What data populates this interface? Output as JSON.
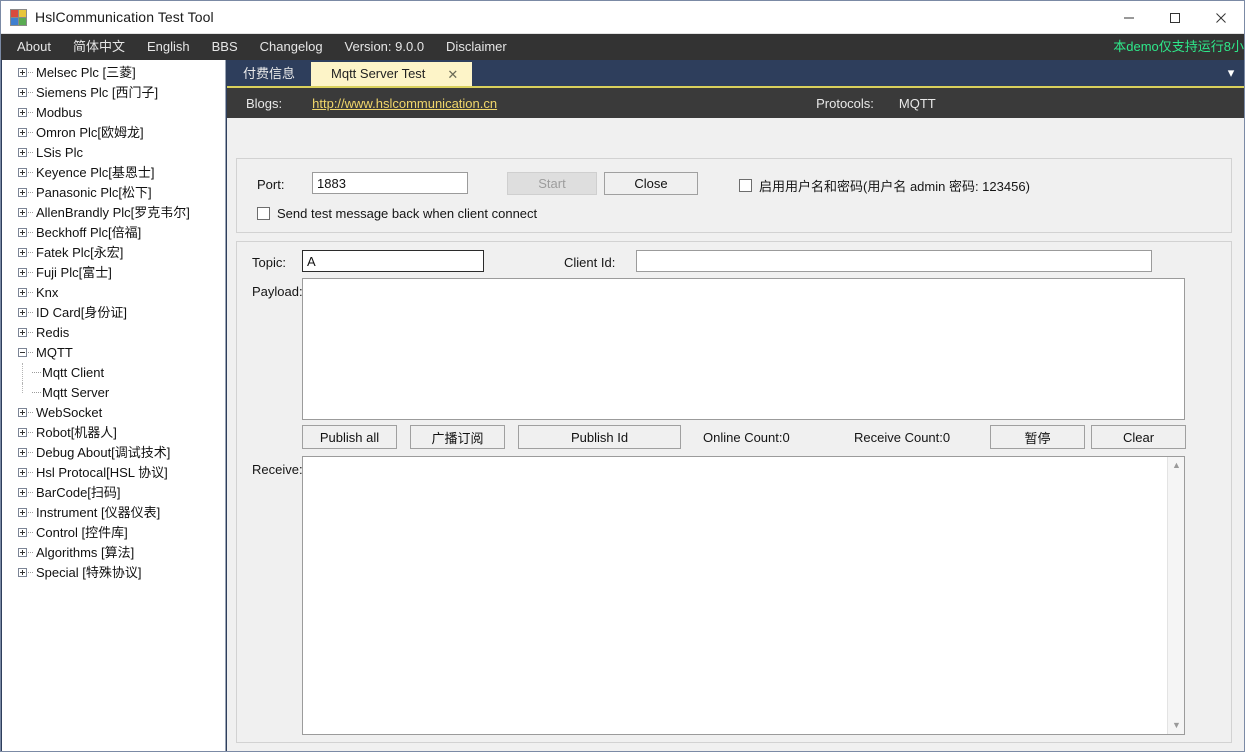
{
  "window": {
    "title": "HslCommunication Test Tool",
    "icon": "app-icon",
    "minimize": "—",
    "maximize": "□",
    "close": "✕"
  },
  "menubar": {
    "items": [
      {
        "label": "About"
      },
      {
        "label": "简体中文"
      },
      {
        "label": "English"
      },
      {
        "label": "BBS"
      },
      {
        "label": "Changelog"
      },
      {
        "label": "Version: 9.0.0"
      },
      {
        "label": "Disclaimer"
      }
    ],
    "notice": "本demo仅支持运行8小",
    "notice_color": "#2ee88a"
  },
  "tree": {
    "items": [
      {
        "label": "Melsec Plc [三菱]",
        "expanded": false,
        "level": 0
      },
      {
        "label": "Siemens Plc [西门子]",
        "expanded": false,
        "level": 0
      },
      {
        "label": "Modbus",
        "expanded": false,
        "level": 0
      },
      {
        "label": "Omron Plc[欧姆龙]",
        "expanded": false,
        "level": 0
      },
      {
        "label": "LSis Plc",
        "expanded": false,
        "level": 0
      },
      {
        "label": "Keyence Plc[基恩士]",
        "expanded": false,
        "level": 0
      },
      {
        "label": "Panasonic Plc[松下]",
        "expanded": false,
        "level": 0
      },
      {
        "label": "AllenBrandly Plc[罗克韦尔]",
        "expanded": false,
        "level": 0
      },
      {
        "label": "Beckhoff Plc[倍福]",
        "expanded": false,
        "level": 0
      },
      {
        "label": "Fatek Plc[永宏]",
        "expanded": false,
        "level": 0
      },
      {
        "label": "Fuji Plc[富士]",
        "expanded": false,
        "level": 0
      },
      {
        "label": "Knx",
        "expanded": false,
        "level": 0
      },
      {
        "label": "ID Card[身份证]",
        "expanded": false,
        "level": 0
      },
      {
        "label": "Redis",
        "expanded": false,
        "level": 0
      },
      {
        "label": "MQTT",
        "expanded": true,
        "level": 0
      },
      {
        "label": "Mqtt Client",
        "expanded": null,
        "level": 1
      },
      {
        "label": "Mqtt Server",
        "expanded": null,
        "level": 1
      },
      {
        "label": "WebSocket",
        "expanded": false,
        "level": 0
      },
      {
        "label": "Robot[机器人]",
        "expanded": false,
        "level": 0
      },
      {
        "label": "Debug About[调试技术]",
        "expanded": false,
        "level": 0
      },
      {
        "label": "Hsl Protocal[HSL 协议]",
        "expanded": false,
        "level": 0
      },
      {
        "label": "BarCode[扫码]",
        "expanded": false,
        "level": 0
      },
      {
        "label": "Instrument [仪器仪表]",
        "expanded": false,
        "level": 0
      },
      {
        "label": "Control [控件库]",
        "expanded": false,
        "level": 0
      },
      {
        "label": "Algorithms [算法]",
        "expanded": false,
        "level": 0
      },
      {
        "label": "Special [特殊协议]",
        "expanded": false,
        "level": 0
      }
    ]
  },
  "tabs": {
    "inactive": "付费信息",
    "active": "Mqtt Server Test",
    "close_glyph": "✕",
    "overflow_glyph": "▾",
    "active_bg": "#fdf4c8"
  },
  "info_strip": {
    "blogs_label": "Blogs:",
    "blogs_url": "http://www.hslcommunication.cn",
    "protocols_label": "Protocols:",
    "protocols_value": "MQTT"
  },
  "server_group": {
    "port_label": "Port:",
    "port_value": "1883",
    "port_placeholder": "",
    "start_label": "Start",
    "start_enabled": false,
    "close_label": "Close",
    "close_enabled": true,
    "auth_checkbox": "启用用户名和密码(用户名 admin  密码: 123456)",
    "auth_checked": false,
    "echo_checkbox": "Send test message back when client connect",
    "echo_checked": false
  },
  "publish_group": {
    "topic_label": "Topic:",
    "topic_value": "A",
    "client_id_label": "Client Id:",
    "client_id_value": "",
    "payload_label": "Payload:",
    "payload_value": "",
    "receive_label": "Receive:",
    "receive_value": "",
    "buttons": {
      "publish_all": "Publish all",
      "broadcast_subscribe": "广播订阅",
      "publish_id": "Publish Id",
      "pause": "暂停",
      "clear": "Clear"
    },
    "online_count": "Online Count:0",
    "receive_count": "Receive Count:0",
    "scroll_up_glyph": "▲",
    "scroll_down_glyph": "▼"
  }
}
